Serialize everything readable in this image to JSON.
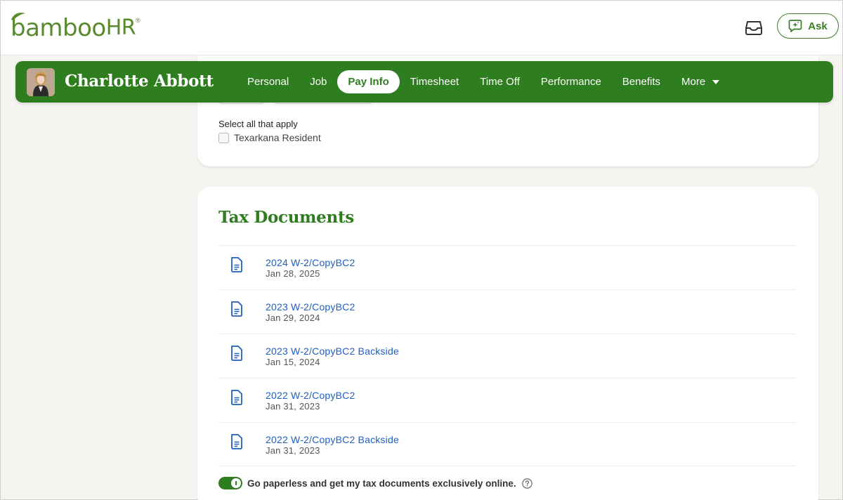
{
  "brand": {
    "name": "bamboo",
    "suffix": "HR",
    "registered": "®",
    "color": "#5a8a2e"
  },
  "header": {
    "inbox_icon": "inbox-tray-icon",
    "ask_label": "Ask",
    "ask_icon": "sparkle-chat-icon"
  },
  "employee": {
    "name": "Charlotte Abbott",
    "tabs": [
      {
        "label": "Personal",
        "active": false
      },
      {
        "label": "Job",
        "active": false
      },
      {
        "label": "Pay Info",
        "active": true
      },
      {
        "label": "Timesheet",
        "active": false
      },
      {
        "label": "Time Off",
        "active": false
      },
      {
        "label": "Performance",
        "active": false
      },
      {
        "label": "Benefits",
        "active": false
      },
      {
        "label": "More",
        "active": false
      }
    ],
    "bar_color": "#2e7d1f"
  },
  "residency": {
    "select_label": "Select all that apply",
    "options": [
      {
        "label": "Texarkana Resident",
        "checked": false
      }
    ]
  },
  "tax_documents": {
    "title": "Tax Documents",
    "items": [
      {
        "name": "2024 W-2/CopyBC2",
        "date": "Jan 28, 2025"
      },
      {
        "name": "2023 W-2/CopyBC2",
        "date": "Jan 29, 2024"
      },
      {
        "name": "2023 W-2/CopyBC2 Backside",
        "date": "Jan 15, 2024"
      },
      {
        "name": "2022 W-2/CopyBC2",
        "date": "Jan 31, 2023"
      },
      {
        "name": "2022 W-2/CopyBC2 Backside",
        "date": "Jan 31, 2023"
      }
    ],
    "link_color": "#1f5fbf",
    "paperless": {
      "label": "Go paperless and get my tax documents exclusively online.",
      "enabled": true,
      "help_icon": "question-circle-icon"
    }
  }
}
